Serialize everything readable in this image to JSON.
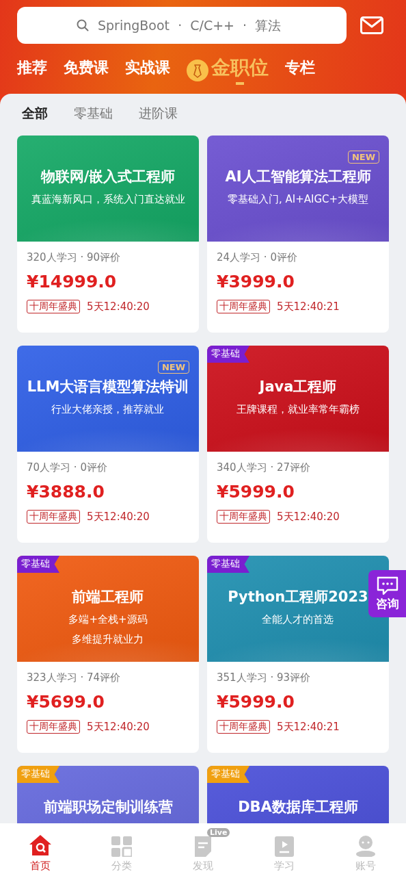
{
  "search": {
    "placeholder": "SpringBoot  ·  C/C++  ·  算法"
  },
  "nav_tabs": [
    {
      "label": "推荐",
      "kind": "text",
      "selected": false
    },
    {
      "label": "免费课",
      "kind": "text",
      "selected": false
    },
    {
      "label": "实战课",
      "kind": "text",
      "selected": false
    },
    {
      "label": "金职位",
      "kind": "special",
      "selected": true
    },
    {
      "label": "专栏",
      "kind": "text",
      "selected": false
    }
  ],
  "filter_tabs": [
    {
      "label": "全部",
      "selected": true
    },
    {
      "label": "零基础",
      "selected": false
    },
    {
      "label": "进阶课",
      "selected": false
    }
  ],
  "courses": [
    {
      "color": "#14a865",
      "title": "物联网/嵌入式工程师",
      "subtitle": [
        "真蓝海新风口，系统入门直达就业"
      ],
      "stats": "320人学习 · 90评价",
      "price": "¥14999.0",
      "tag": "十周年盛典",
      "countdown": "5天12:40:20"
    },
    {
      "color": "#6a4fd0",
      "badge": {
        "kind": "new",
        "text": "NEW"
      },
      "title": "AI人工智能算法工程师",
      "subtitle": [
        "零基础入门, AI+AIGC+大模型"
      ],
      "stats": "24人学习 · 0评价",
      "price": "¥3999.0",
      "tag": "十周年盛典",
      "countdown": "5天12:40:21"
    },
    {
      "color": "#2f5fe6",
      "badge": {
        "kind": "new",
        "text": "NEW"
      },
      "title": "LLM大语言模型算法特训",
      "subtitle": [
        "行业大佬亲授，推荐就业"
      ],
      "stats": "70人学习 · 0评价",
      "price": "¥3888.0",
      "tag": "十周年盛典",
      "countdown": "5天12:40:20"
    },
    {
      "color": "#cc0f1a",
      "badge": {
        "kind": "level",
        "text": "零基础",
        "color": "#7a1fd0"
      },
      "title": "Java工程师",
      "subtitle": [
        "王牌课程，就业率常年霸榜"
      ],
      "stats": "340人学习 · 27评价",
      "price": "¥5999.0",
      "tag": "十周年盛典",
      "countdown": "5天12:40:20"
    },
    {
      "color": "#f05a10",
      "badge": {
        "kind": "level",
        "text": "零基础",
        "color": "#7a1fd0"
      },
      "title": "前端工程师",
      "subtitle": [
        "多端+全栈+源码",
        "多维提升就业力"
      ],
      "stats": "323人学习 · 74评价",
      "price": "¥5699.0",
      "tag": "十周年盛典",
      "countdown": "5天12:40:20"
    },
    {
      "color": "#1f8fb0",
      "badge": {
        "kind": "level",
        "text": "零基础",
        "color": "#7a1fd0"
      },
      "title": "Python工程师2023",
      "subtitle": [
        "全能人才的首选"
      ],
      "stats": "351人学习 · 93评价",
      "price": "¥5999.0",
      "tag": "十周年盛典",
      "countdown": "5天12:40:21"
    },
    {
      "color": "#6468dc",
      "badge": {
        "kind": "level",
        "text": "零基础",
        "color": "#f0a010"
      },
      "title": "前端职场定制训练营"
    },
    {
      "color": "#4a4fd8",
      "badge": {
        "kind": "level",
        "text": "零基础",
        "color": "#f0a010"
      },
      "title": "DBA数据库工程师"
    }
  ],
  "consult_button": {
    "label": "咨询"
  },
  "bottom_nav": [
    {
      "label": "首页",
      "selected": true
    },
    {
      "label": "分类",
      "selected": false
    },
    {
      "label": "发现",
      "selected": false,
      "badge": "Live"
    },
    {
      "label": "学习",
      "selected": false
    },
    {
      "label": "账号",
      "selected": false
    }
  ]
}
